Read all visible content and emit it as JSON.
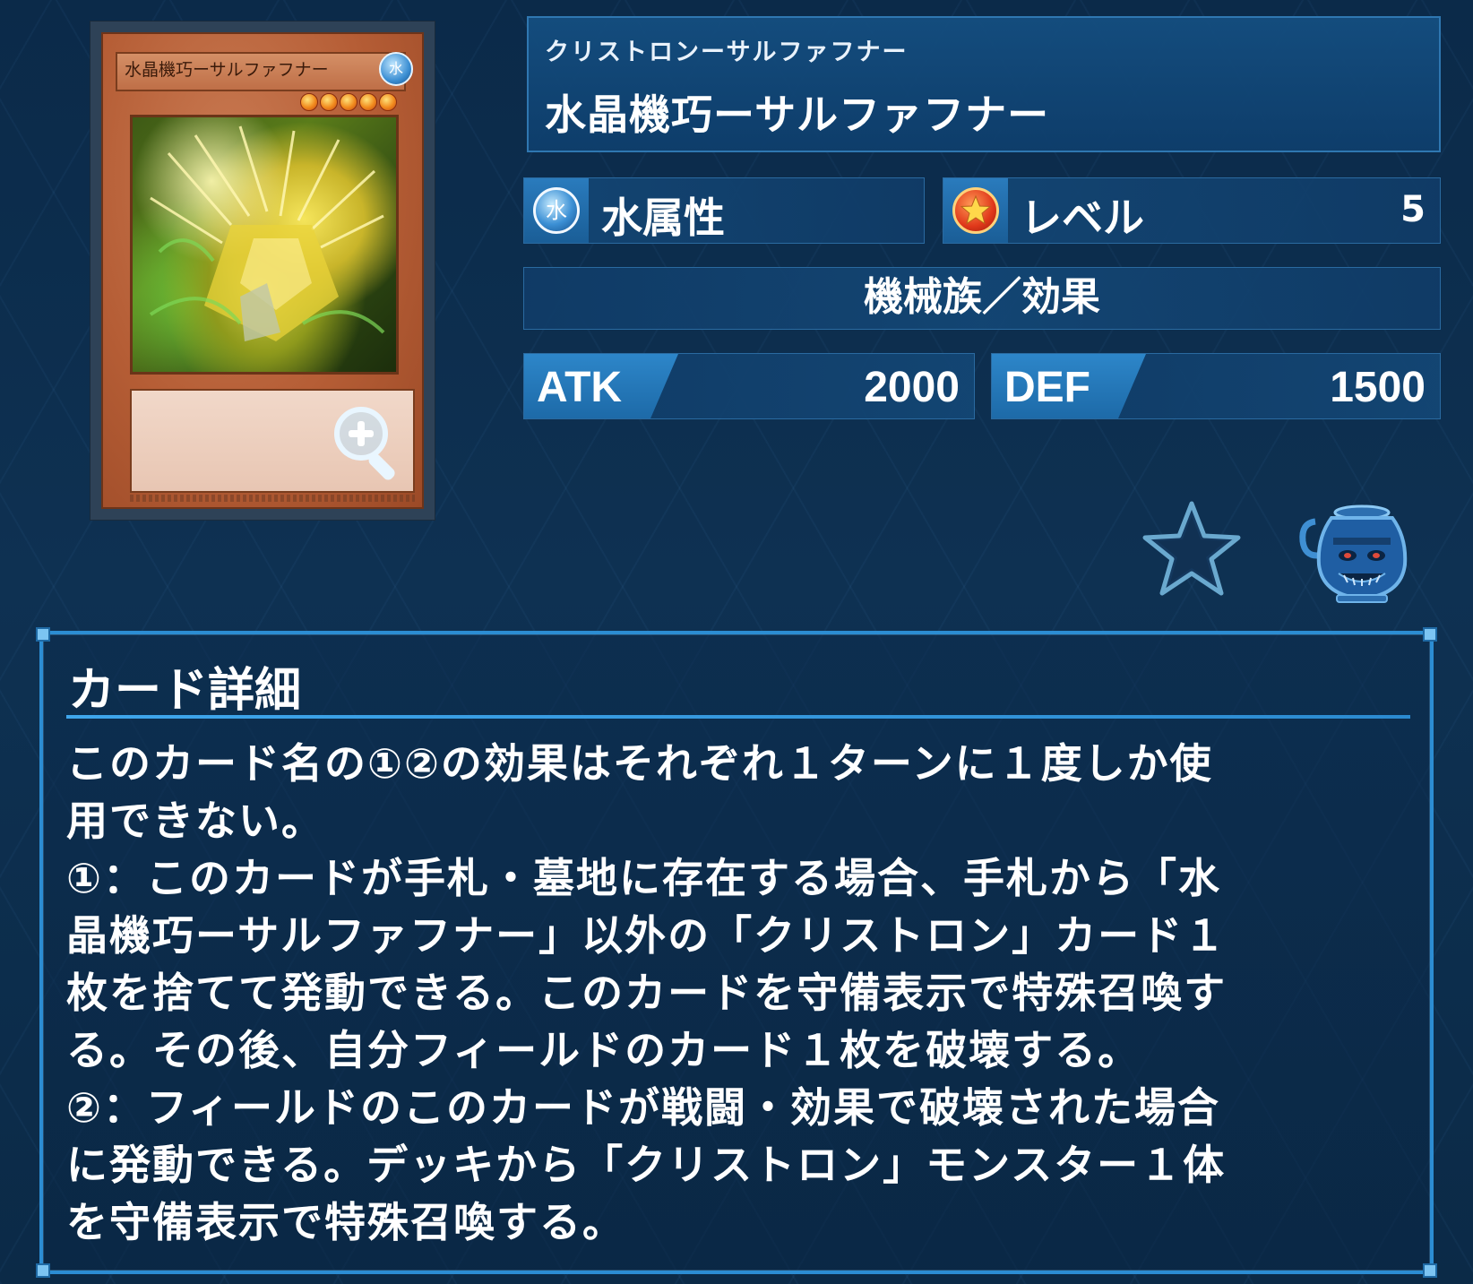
{
  "card_image": {
    "frame_name": "水晶機巧ーサルファフナー",
    "frame_ruby": "クリストロンーサルファフナー",
    "attribute_glyph": "水",
    "stars": 5
  },
  "card": {
    "ruby": "クリストロンーサルファフナー",
    "name": "水晶機巧ーサルファフナー",
    "attribute_icon": "water-attribute-icon",
    "attribute_glyph": "水",
    "attribute": "水属性",
    "level_icon": "level-star-icon",
    "level_label": "レベル",
    "level_value": "5",
    "type": "機械族／効果",
    "atk_label": "ATK",
    "atk_value": "2000",
    "def_label": "DEF",
    "def_value": "1500"
  },
  "actions": {
    "zoom_icon": "zoom-in-icon",
    "favorite_icon": "star-icon",
    "pot_icon": "pot-of-greed-icon"
  },
  "details": {
    "heading": "カード詳細",
    "text": "このカード名の①②の効果はそれぞれ１ターンに１度しか使\n用できない。\n①：このカードが手札・墓地に存在する場合、手札から「水\n晶機巧ーサルファフナー」以外の「クリストロン」カード１\n枚を捨てて発動できる。このカードを守備表示で特殊召喚す\nる。その後、自分フィールドのカード１枚を破壊する。\n②：フィールドのこのカードが戦闘・効果で破壊された場合\nに発動できる。デッキから「クリストロン」モンスター１体\nを守備表示で特殊召喚する。"
  },
  "colors": {
    "background": "#0e3152",
    "panel": "#134674",
    "accent_border": "#2c8dd3",
    "stat_tag": "#2d86c9"
  }
}
